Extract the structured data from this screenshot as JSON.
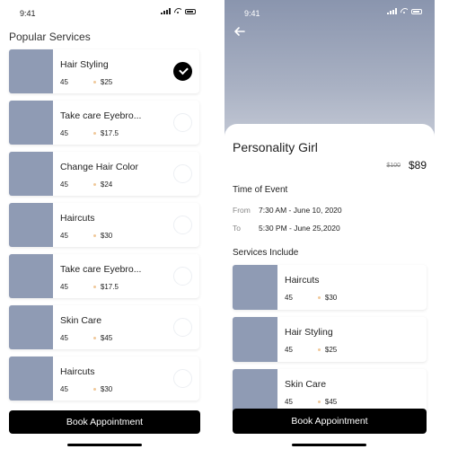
{
  "status": {
    "time": "9:41"
  },
  "left": {
    "section_title": "Popular Services",
    "services": [
      {
        "name": "Hair Styling",
        "count": "45",
        "price": "$25",
        "selected": true
      },
      {
        "name": "Take care Eyebro...",
        "count": "45",
        "price": "$17.5",
        "selected": false
      },
      {
        "name": "Change Hair Color",
        "count": "45",
        "price": "$24",
        "selected": false
      },
      {
        "name": "Haircuts",
        "count": "45",
        "price": "$30",
        "selected": false
      },
      {
        "name": "Take care Eyebro...",
        "count": "45",
        "price": "$17.5",
        "selected": false
      },
      {
        "name": "Skin Care",
        "count": "45",
        "price": "$45",
        "selected": false
      },
      {
        "name": "Haircuts",
        "count": "45",
        "price": "$30",
        "selected": false
      }
    ],
    "book_button": "Book Appointment"
  },
  "right": {
    "title": "Personality Girl",
    "old_price": "$100",
    "price": "$89",
    "time_heading": "Time of Event",
    "from_label": "From",
    "from_value": "7:30 AM - June 10, 2020",
    "to_label": "To",
    "to_value": "5:30 PM - June 25,2020",
    "services_heading": "Services Include",
    "services": [
      {
        "name": "Haircuts",
        "count": "45",
        "price": "$30"
      },
      {
        "name": "Hair Styling",
        "count": "45",
        "price": "$25"
      },
      {
        "name": "Skin Care",
        "count": "45",
        "price": "$45"
      }
    ],
    "book_button": "Book Appointment"
  },
  "colors": {
    "thumb": "#8f9bb4",
    "primary_button": "#000000",
    "star_dot": "#f0c89a"
  },
  "icons": [
    "signal-icon",
    "wifi-icon",
    "battery-icon",
    "check-icon",
    "back-arrow-icon"
  ]
}
